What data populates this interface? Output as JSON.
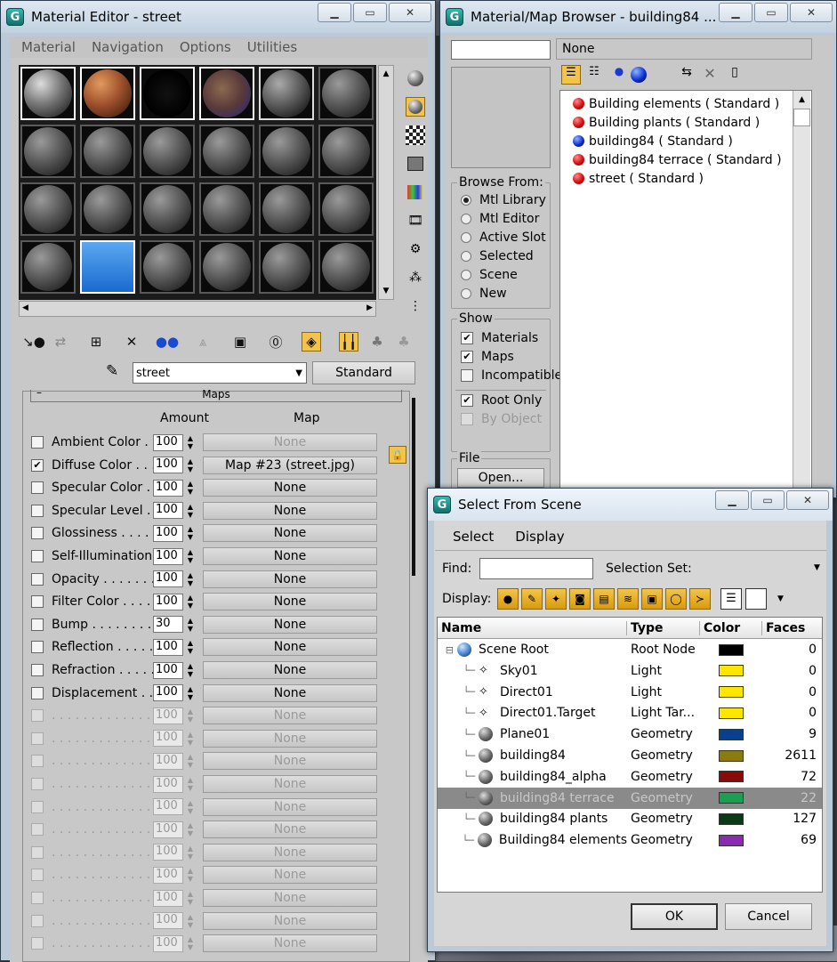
{
  "material_editor": {
    "title": "Material Editor - street",
    "menu": [
      "Material",
      "Navigation",
      "Options",
      "Utilities"
    ],
    "material_name": "street",
    "material_type": "Standard",
    "maps_rollout_title": "Maps",
    "col_amount": "Amount",
    "col_map": "Map",
    "maps": [
      {
        "label": "Ambient Color . . .",
        "checked": false,
        "amount": "100",
        "map": "None",
        "enabled": true,
        "map_dim": true
      },
      {
        "label": "Diffuse Color . . . .",
        "checked": true,
        "amount": "100",
        "map": "Map #23 (street.jpg)",
        "enabled": true,
        "map_dim": false
      },
      {
        "label": "Specular Color . .",
        "checked": false,
        "amount": "100",
        "map": "None",
        "enabled": true,
        "map_dim": false
      },
      {
        "label": "Specular Level . .",
        "checked": false,
        "amount": "100",
        "map": "None",
        "enabled": true,
        "map_dim": false
      },
      {
        "label": "Glossiness . . . . .",
        "checked": false,
        "amount": "100",
        "map": "None",
        "enabled": true,
        "map_dim": false
      },
      {
        "label": "Self-Illumination . .",
        "checked": false,
        "amount": "100",
        "map": "None",
        "enabled": true,
        "map_dim": false
      },
      {
        "label": "Opacity . . . . . . .",
        "checked": false,
        "amount": "100",
        "map": "None",
        "enabled": true,
        "map_dim": false
      },
      {
        "label": "Filter Color . . . . .",
        "checked": false,
        "amount": "100",
        "map": "None",
        "enabled": true,
        "map_dim": false
      },
      {
        "label": "Bump . . . . . . . . .",
        "checked": false,
        "amount": "30",
        "map": "None",
        "enabled": true,
        "map_dim": false
      },
      {
        "label": "Reflection . . . . .",
        "checked": false,
        "amount": "100",
        "map": "None",
        "enabled": true,
        "map_dim": false
      },
      {
        "label": "Refraction . . . . .",
        "checked": false,
        "amount": "100",
        "map": "None",
        "enabled": true,
        "map_dim": false
      },
      {
        "label": "Displacement . . .",
        "checked": false,
        "amount": "100",
        "map": "None",
        "enabled": true,
        "map_dim": false
      },
      {
        "label": ". . . . . . . . . . . . .",
        "checked": false,
        "amount": "100",
        "map": "None",
        "enabled": false,
        "map_dim": true
      },
      {
        "label": ". . . . . . . . . . . . .",
        "checked": false,
        "amount": "100",
        "map": "None",
        "enabled": false,
        "map_dim": true
      },
      {
        "label": ". . . . . . . . . . . . .",
        "checked": false,
        "amount": "100",
        "map": "None",
        "enabled": false,
        "map_dim": true
      },
      {
        "label": ". . . . . . . . . . . . .",
        "checked": false,
        "amount": "100",
        "map": "None",
        "enabled": false,
        "map_dim": true
      },
      {
        "label": ". . . . . . . . . . . . .",
        "checked": false,
        "amount": "100",
        "map": "None",
        "enabled": false,
        "map_dim": true
      },
      {
        "label": ". . . . . . . . . . . . .",
        "checked": false,
        "amount": "100",
        "map": "None",
        "enabled": false,
        "map_dim": true
      },
      {
        "label": ". . . . . . . . . . . . .",
        "checked": false,
        "amount": "100",
        "map": "None",
        "enabled": false,
        "map_dim": true
      },
      {
        "label": ". . . . . . . . . . . . .",
        "checked": false,
        "amount": "100",
        "map": "None",
        "enabled": false,
        "map_dim": true
      },
      {
        "label": ". . . . . . . . . . . . .",
        "checked": false,
        "amount": "100",
        "map": "None",
        "enabled": false,
        "map_dim": true
      },
      {
        "label": ". . . . . . . . . . . . .",
        "checked": false,
        "amount": "100",
        "map": "None",
        "enabled": false,
        "map_dim": true
      },
      {
        "label": ". . . . . . . . . . . . .",
        "checked": false,
        "amount": "100",
        "map": "None",
        "enabled": false,
        "map_dim": true
      }
    ]
  },
  "browser": {
    "title": "Material/Map Browser - building84 ...",
    "name_value": "None",
    "browse_from_label": "Browse From:",
    "browse_from": [
      {
        "label": "Mtl Library",
        "selected": true
      },
      {
        "label": "Mtl Editor",
        "selected": false
      },
      {
        "label": "Active Slot",
        "selected": false
      },
      {
        "label": "Selected",
        "selected": false
      },
      {
        "label": "Scene",
        "selected": false
      },
      {
        "label": "New",
        "selected": false
      }
    ],
    "show_label": "Show",
    "show": [
      {
        "label": "Materials",
        "checked": true,
        "enabled": true
      },
      {
        "label": "Maps",
        "checked": true,
        "enabled": true
      },
      {
        "label": "Incompatible",
        "checked": false,
        "enabled": true
      }
    ],
    "root_only": {
      "label": "Root Only",
      "checked": true
    },
    "by_object": {
      "label": "By Object",
      "checked": false
    },
    "file_label": "File",
    "open_button": "Open...",
    "items": [
      {
        "label": "Building elements  ( Standard )",
        "color": "red"
      },
      {
        "label": "Building plants  ( Standard )",
        "color": "red"
      },
      {
        "label": "building84  ( Standard )",
        "color": "blue"
      },
      {
        "label": "building84 terrace  ( Standard )",
        "color": "red"
      },
      {
        "label": "street  ( Standard )",
        "color": "red"
      }
    ]
  },
  "scene_dialog": {
    "title": "Select From Scene",
    "menu": [
      "Select",
      "Display"
    ],
    "find_label": "Find:",
    "find_value": "",
    "selection_set_label": "Selection Set:",
    "display_label": "Display:",
    "columns": {
      "name": "Name",
      "type": "Type",
      "color": "Color",
      "faces": "Faces"
    },
    "rows": [
      {
        "name": "Scene Root",
        "type": "Root Node",
        "color": "#000000",
        "faces": "0",
        "icon": "globe-icon",
        "level": 0,
        "highlight": false
      },
      {
        "name": "Sky01",
        "type": "Light",
        "color": "#ffe600",
        "faces": "0",
        "icon": "light-icon",
        "level": 1,
        "highlight": false
      },
      {
        "name": "Direct01",
        "type": "Light",
        "color": "#ffe600",
        "faces": "0",
        "icon": "light-icon",
        "level": 1,
        "highlight": false
      },
      {
        "name": "Direct01.Target",
        "type": "Light Tar...",
        "color": "#ffe600",
        "faces": "0",
        "icon": "light-icon",
        "level": 1,
        "highlight": false
      },
      {
        "name": "Plane01",
        "type": "Geometry",
        "color": "#0a3f8c",
        "faces": "9",
        "icon": "geometry-icon",
        "level": 1,
        "highlight": false
      },
      {
        "name": "building84",
        "type": "Geometry",
        "color": "#8a7a10",
        "faces": "2611",
        "icon": "geometry-icon",
        "level": 1,
        "highlight": false
      },
      {
        "name": "building84_alpha",
        "type": "Geometry",
        "color": "#8a0a0a",
        "faces": "72",
        "icon": "geometry-icon",
        "level": 1,
        "highlight": false
      },
      {
        "name": "building84 terrace",
        "type": "Geometry",
        "color": "#1aa050",
        "faces": "22",
        "icon": "geometry-icon",
        "level": 1,
        "highlight": true
      },
      {
        "name": "building84 plants",
        "type": "Geometry",
        "color": "#0a3a16",
        "faces": "127",
        "icon": "geometry-icon",
        "level": 1,
        "highlight": false
      },
      {
        "name": "Building84 elements",
        "type": "Geometry",
        "color": "#8a2ab0",
        "faces": "69",
        "icon": "geometry-icon",
        "level": 1,
        "highlight": false
      }
    ],
    "ok_button": "OK",
    "cancel_button": "Cancel"
  }
}
